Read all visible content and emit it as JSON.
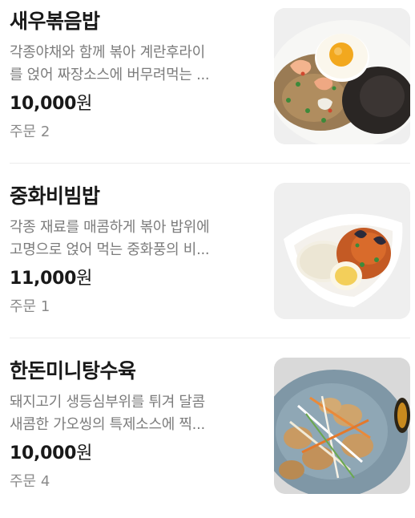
{
  "menu": {
    "items": [
      {
        "name": "새우볶음밥",
        "desc_line1": "각종야채와 함께 볶아 계란후라이",
        "desc_line2": "를 얹어 짜장소스에 버무려먹는 ...",
        "price": "10,000",
        "currency": "원",
        "orders": "주문 2",
        "image_icon": "shrimp-fried-rice-photo"
      },
      {
        "name": "중화비빔밥",
        "desc_line1": "각종 재료를 매콤하게 볶아 밥위에",
        "desc_line2": "고명으로 얹어 먹는 중화풍의 비...",
        "price": "11,000",
        "currency": "원",
        "orders": "주문 1",
        "image_icon": "chinese-bibimbap-photo"
      },
      {
        "name": "한돈미니탕수육",
        "desc_line1": "돼지고기 생등심부위를 튀겨 달콤",
        "desc_line2": "새콤한 가오씽의 특제소스에 찍...",
        "price": "10,000",
        "currency": "원",
        "orders": "주문 4",
        "image_icon": "sweet-and-sour-pork-photo"
      }
    ]
  },
  "colors": {
    "text_primary": "#191919",
    "text_secondary": "#7c7c7c",
    "divider": "#ececec",
    "thumb_bg": "#efefef"
  }
}
